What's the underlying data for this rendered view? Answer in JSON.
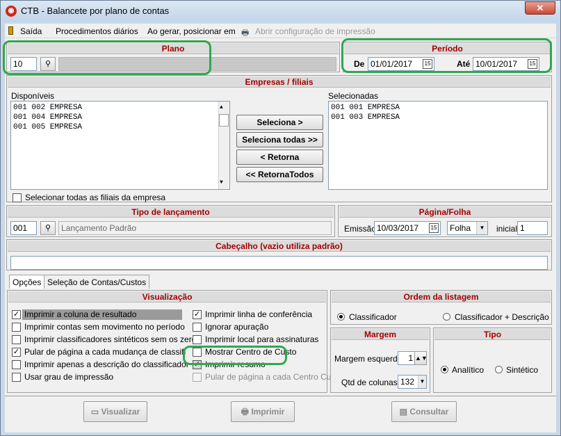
{
  "window": {
    "title": "CTB - Balancete por plano de contas",
    "close_glyph": "✕"
  },
  "menu": {
    "exit": "Saída",
    "daily": "Procedimentos diários",
    "on_generate": "Ao gerar, posicionar em",
    "print_config": "Abrir configuração de impressão"
  },
  "plano": {
    "title": "Plano",
    "code": "10",
    "description": ""
  },
  "periodo": {
    "title": "Período",
    "from_label": "De",
    "from": "01/01/2017",
    "to_label": "Até",
    "to": "10/01/2017"
  },
  "empresas": {
    "title": "Empresas / filiais",
    "available_label": "Disponíveis",
    "available": [
      "001  002  EMPRESA",
      "001  004  EMPRESA",
      "001  005  EMPRESA"
    ],
    "selected_label": "Selecionadas",
    "selected": [
      "001  001  EMPRESA",
      "001  003  EMPRESA"
    ],
    "btn_select": "Seleciona >",
    "btn_select_all": "Seleciona todas >>",
    "btn_return": "< Retorna",
    "btn_return_all": "<< RetornaTodos",
    "select_all_branches": "Selecionar todas as filiais da empresa"
  },
  "lancamento": {
    "title": "Tipo de lançamento",
    "code": "001",
    "description": "Lançamento Padrão"
  },
  "pagina": {
    "title": "Página/Folha",
    "emission_label": "Emissão",
    "emission": "10/03/2017",
    "mode": "Folha",
    "initial_label": "inicial",
    "initial": "1"
  },
  "cabecalho": {
    "title": "Cabeçalho (vazio utiliza padrão)",
    "value": ""
  },
  "tabs": [
    "Opções",
    "Seleção de Contas/Custos"
  ],
  "visualizacao": {
    "title": "Visualização",
    "left": [
      {
        "label": "Imprimir a coluna de resultado",
        "checked": true
      },
      {
        "label": "Imprimir contas sem movimento no período",
        "checked": false
      },
      {
        "label": "Imprimir classificadores sintéticos sem os zeros",
        "checked": false
      },
      {
        "label": "Pular de página a cada mudança de classificador",
        "checked": true
      },
      {
        "label": "Imprimir apenas a descrição do classificador",
        "checked": false
      },
      {
        "label": "Usar grau de impressão",
        "checked": false
      }
    ],
    "right": [
      {
        "label": "Imprimir linha de conferência",
        "checked": true
      },
      {
        "label": "Ignorar apuração",
        "checked": false
      },
      {
        "label": "Imprimir local para assinaturas",
        "checked": false
      },
      {
        "label": "Mostrar Centro de Custo",
        "checked": false
      },
      {
        "label": "Imprimir resumo",
        "checked": true
      },
      {
        "label": "Pular de página a cada Centro Custo",
        "checked": false,
        "disabled": true
      }
    ]
  },
  "ordem": {
    "title": "Ordem da listagem",
    "opt1": "Classificador",
    "opt2": "Classificador + Descrição"
  },
  "margem": {
    "title": "Margem",
    "left_label": "Margem esquerda",
    "left": "1",
    "cols_label": "Qtd de colunas",
    "cols": "132"
  },
  "tipo": {
    "title": "Tipo",
    "opt1": "Analítico",
    "opt2": "Sintético"
  },
  "actions": {
    "view": "Visualizar",
    "print": "Imprimir",
    "query": "Consultar"
  },
  "colors": {
    "highlight": "#2fa84f",
    "section_title": "#a30000"
  }
}
